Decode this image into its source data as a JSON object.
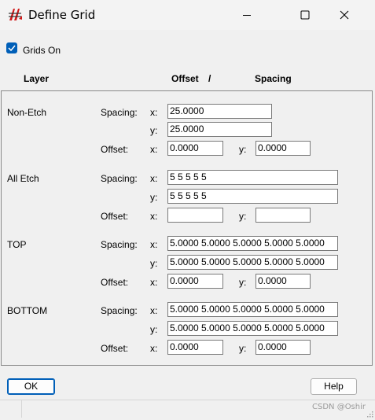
{
  "window": {
    "title": "Define Grid",
    "icon": "grid-app-icon",
    "controls": [
      "minimize-icon",
      "maximize-icon",
      "close-icon"
    ]
  },
  "grids_on": {
    "label": "Grids On",
    "checked": true
  },
  "headers": {
    "layer": "Layer",
    "offset": "Offset",
    "slash": "/",
    "spacing": "Spacing"
  },
  "field_labels": {
    "spacing": "Spacing:",
    "offset": "Offset:",
    "x": "x:",
    "y": "y:"
  },
  "layers": [
    {
      "name": "Non-Etch",
      "spacing_x": "25.0000",
      "spacing_y": "25.0000",
      "offset_x": "0.0000",
      "offset_y": "0.0000"
    },
    {
      "name": "All Etch",
      "spacing_x": "5 5 5 5 5",
      "spacing_y": "5 5 5 5 5",
      "offset_x": "",
      "offset_y": ""
    },
    {
      "name": "TOP",
      "spacing_x": "5.0000 5.0000 5.0000 5.0000 5.0000",
      "spacing_y": "5.0000 5.0000 5.0000 5.0000 5.0000",
      "offset_x": "0.0000",
      "offset_y": "0.0000"
    },
    {
      "name": "BOTTOM",
      "spacing_x": "5.0000 5.0000 5.0000 5.0000 5.0000",
      "spacing_y": "5.0000 5.0000 5.0000 5.0000 5.0000",
      "offset_x": "0.0000",
      "offset_y": "0.0000"
    }
  ],
  "buttons": {
    "ok": "OK",
    "help": "Help"
  },
  "watermark": "CSDN @Oshir",
  "colors": {
    "accent": "#005fb8",
    "background": "#f0f0f0"
  }
}
